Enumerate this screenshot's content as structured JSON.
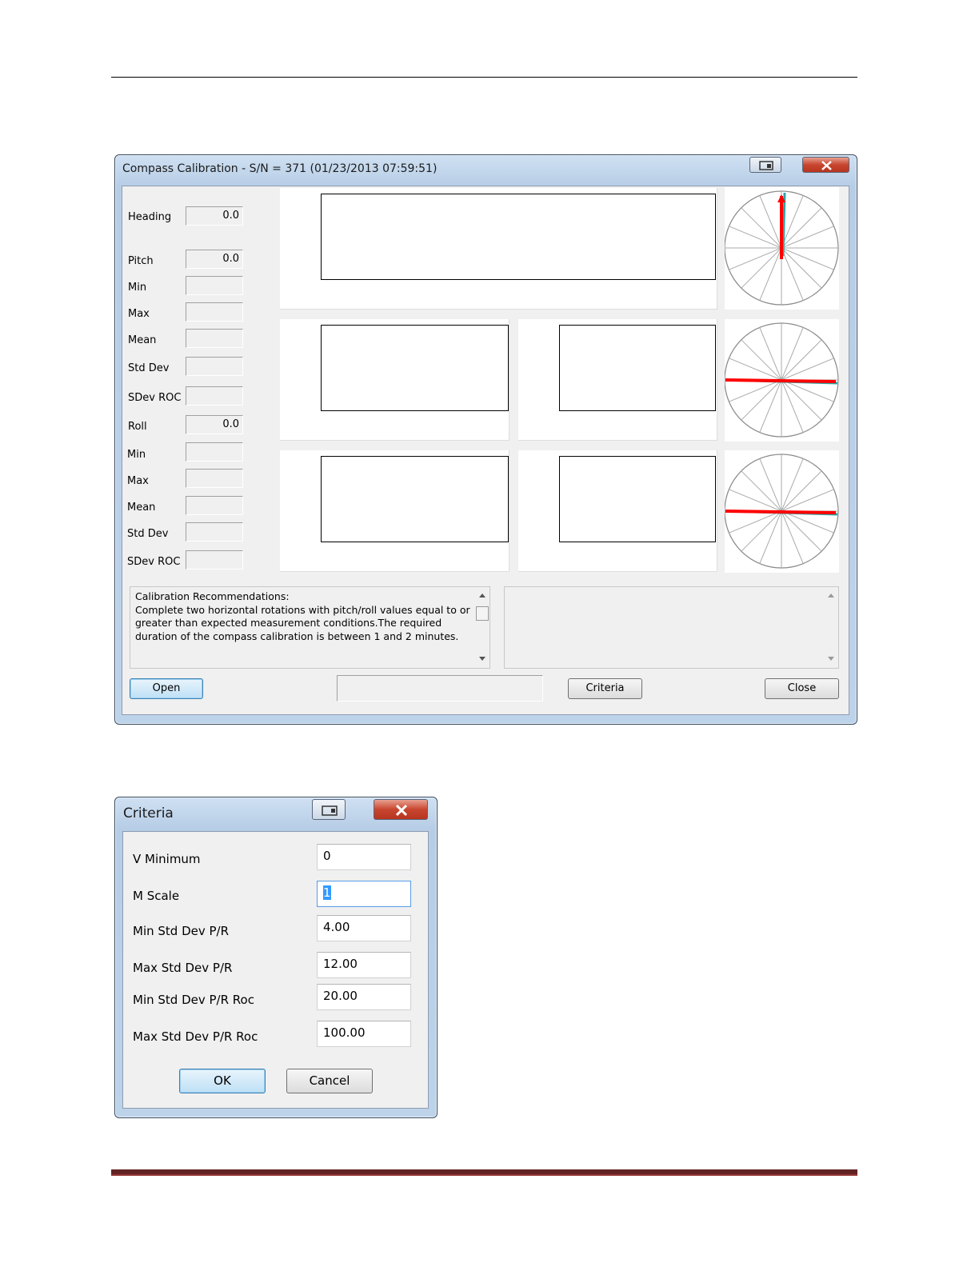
{
  "calibration_window": {
    "title": "Compass Calibration - S/N = 371 (01/23/2013 07:59:51)",
    "heading": {
      "label": "Heading",
      "value": "0.0"
    },
    "pitch": {
      "label": "Pitch",
      "value": "0.0",
      "stats": [
        {
          "label": "Min",
          "value": ""
        },
        {
          "label": "Max",
          "value": ""
        },
        {
          "label": "Mean",
          "value": ""
        },
        {
          "label": "Std Dev",
          "value": ""
        },
        {
          "label": "SDev ROC",
          "value": ""
        }
      ]
    },
    "roll": {
      "label": "Roll",
      "value": "0.0",
      "stats": [
        {
          "label": "Min",
          "value": ""
        },
        {
          "label": "Max",
          "value": ""
        },
        {
          "label": "Mean",
          "value": ""
        },
        {
          "label": "Std Dev",
          "value": ""
        },
        {
          "label": "SDev ROC",
          "value": ""
        }
      ]
    },
    "compass_dials": [
      {
        "name": "heading",
        "needle_angle_deg": 0
      },
      {
        "name": "pitch",
        "needle_angle_deg": 90
      },
      {
        "name": "roll",
        "needle_angle_deg": 90
      }
    ],
    "recommendations": {
      "heading": "Calibration Recommendations:",
      "body": "Complete two horizontal rotations with pitch/roll values equal to or greater than expected measurement conditions.The required duration of the compass calibration is between 1 and 2 minutes."
    },
    "buttons": {
      "open": "Open",
      "criteria": "Criteria",
      "close": "Close"
    },
    "colors": {
      "needle": "#ff0000",
      "needle_shadow": "#2aa6a6"
    }
  },
  "criteria_window": {
    "title": "Criteria",
    "fields": [
      {
        "label": "V Minimum",
        "value": "0"
      },
      {
        "label": "M Scale",
        "value": "1"
      },
      {
        "label": "Min Std Dev P/R",
        "value": "4.00"
      },
      {
        "label": "Max Std Dev P/R",
        "value": "12.00"
      },
      {
        "label": "Min Std Dev P/R Roc",
        "value": "20.00"
      },
      {
        "label": "Max Std Dev P/R Roc",
        "value": "100.00"
      }
    ],
    "buttons": {
      "ok": "OK",
      "cancel": "Cancel"
    }
  }
}
